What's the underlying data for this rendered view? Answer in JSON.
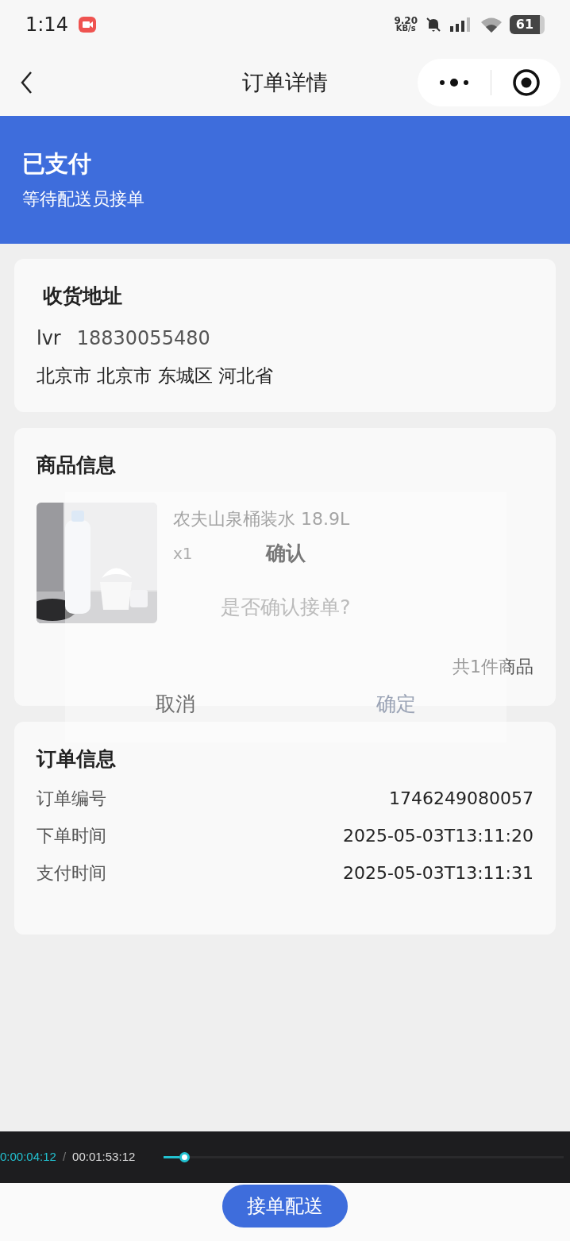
{
  "status_bar": {
    "time": "1:14",
    "net_speed": "9.20",
    "net_unit": "KB/s",
    "battery": "61"
  },
  "nav": {
    "title": "订单详情"
  },
  "header": {
    "status": "已支付",
    "subtitle": "等待配送员接单"
  },
  "address": {
    "title": "收货地址",
    "name": "lvr",
    "phone": "18830055480",
    "address": "北京市 北京市 东城区 河北省"
  },
  "goods": {
    "title": "商品信息",
    "items": [
      {
        "kind": "picture",
        "name": "农夫山泉桶装水 18.9L",
        "qty": "x1"
      }
    ],
    "total": "共1件商品"
  },
  "order_info": {
    "title": "订单信息",
    "rows": [
      {
        "label": "订单编号",
        "value": "1746249080057"
      },
      {
        "label": "下单时间",
        "value": "2025-05-03T13:11:20"
      },
      {
        "label": "支付时间",
        "value": "2025-05-03T13:11:31"
      }
    ]
  },
  "dialog": {
    "title": "确认",
    "message": "是否确认接单?",
    "buttons": [
      {
        "kind": "cancel",
        "label": "取消"
      },
      {
        "kind": "confirm",
        "label": "确定"
      }
    ]
  },
  "video_player": {
    "current": "0:00:04:12",
    "separator": "/",
    "total": "00:01:53:12",
    "level": 0.04
  },
  "action_button": "接单配送"
}
